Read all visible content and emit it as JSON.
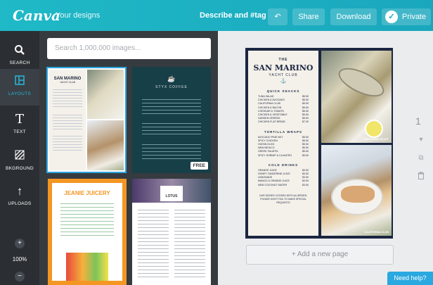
{
  "topbar": {
    "logo": "Canva",
    "your_designs": "Your designs",
    "tagline": "Describe and #tag",
    "undo_icon": "undo-icon",
    "share": "Share",
    "download": "Download",
    "private": "Private",
    "private_check": "✓"
  },
  "rail": {
    "search": "SEARCH",
    "layouts": "LAYOUTS",
    "text": "TEXT",
    "background": "BKGROUND",
    "uploads": "UPLOADS",
    "zoom_plus": "+",
    "zoom": "100%",
    "zoom_minus": "−"
  },
  "panel": {
    "search_placeholder": "Search 1,000,000 images...",
    "thumbs": {
      "t1_title": "SAN MARINO",
      "t1_subtitle": "YACHT CLUB",
      "t2_logo": "☕",
      "t2_title": "STYX COFFEE",
      "t2_badge": "FREE",
      "t3_title": "JEANIE JUICERY",
      "t4_title": "LOTUS"
    }
  },
  "menu": {
    "the": "THE",
    "title": "SAN MARINO",
    "subtitle": "YACHT CLUB",
    "anchor": "⚓",
    "sections": [
      {
        "name": "QUICK SNACKS",
        "items": [
          {
            "name": "TUNA SALAD",
            "price": "$5.50"
          },
          {
            "name": "CHICKEN & AVOCADO",
            "price": "$5.50"
          },
          {
            "name": "CALIFORNIA CLUB",
            "price": "$5.50"
          },
          {
            "name": "CHICKEN & BACON",
            "price": "$5.50"
          },
          {
            "name": "CHEDDAR & TOMATO",
            "price": "$5.50"
          },
          {
            "name": "CHICKEN & VEGETABLE",
            "price": "$5.50"
          },
          {
            "name": "GARDEN GREENS",
            "price": "$5.50"
          },
          {
            "name": "CHICKEN FLAT BREAD",
            "price": "$7.00"
          }
        ]
      },
      {
        "name": "TORTILLA WRAPS",
        "items": [
          {
            "name": "AVOCADO PINE NUT",
            "price": "$5.50"
          },
          {
            "name": "SPICY CHICKEN",
            "price": "$5.50"
          },
          {
            "name": "HOISIN DUCK",
            "price": "$5.50"
          },
          {
            "name": "NEW MEXICO",
            "price": "$5.50"
          },
          {
            "name": "GREEK FALAFEL",
            "price": "$5.50"
          },
          {
            "name": "SPICY SHRIMP & CILANTRO",
            "price": "$5.50"
          }
        ]
      },
      {
        "name": "COLD DRINKS",
        "items": [
          {
            "name": "ORANGE JUICE",
            "price": "$3.50"
          },
          {
            "name": "HONEY TANGERINE JUICE",
            "price": "$3.50"
          },
          {
            "name": "LEMONADE",
            "price": "$3.50"
          },
          {
            "name": "MANGO & ORANGE JUICE",
            "price": "$3.50"
          },
          {
            "name": "NEW COCONUT WATER",
            "price": "$3.50"
          }
        ]
      }
    ],
    "footer": "OUR DISHES COOKED WITH ALLERGEN. PLEASE DON'T FAIL TO MAKE SPECIAL REQUESTS",
    "photo_top_caption": "GRENADINE FILLET",
    "photo_bottom_caption": "CALIFORNIA CLUB"
  },
  "canvas": {
    "add_page": "+ Add a new page",
    "page_number": "1",
    "need_help": "Need help?"
  }
}
